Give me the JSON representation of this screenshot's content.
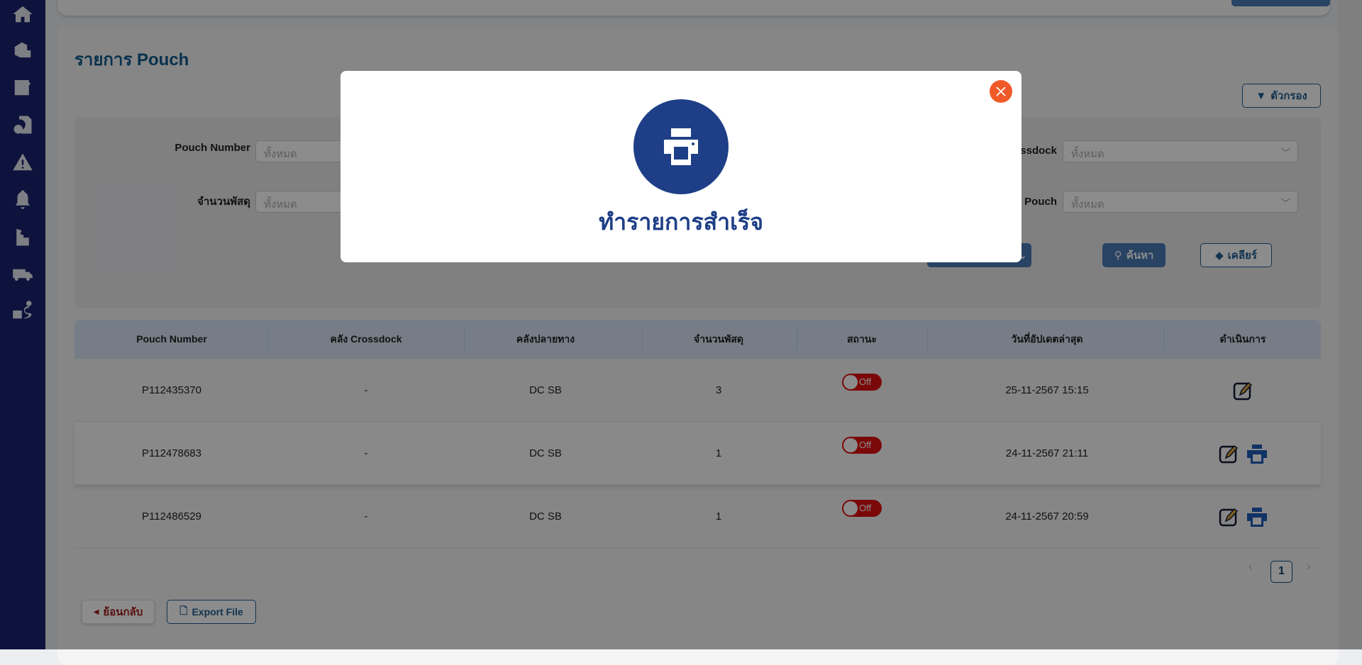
{
  "page": {
    "title": "รายการ Pouch",
    "filter_label": "ตัวกรอง"
  },
  "filters": {
    "pouch_number": {
      "label": "Pouch Number",
      "placeholder": "ทั้งหมด"
    },
    "parcel_count": {
      "label": "จำนวนพัสดุ",
      "placeholder": "ทั้งหมด"
    },
    "crossdock": {
      "label": "คลัง Crossdock",
      "placeholder": "ทั้งหมด"
    },
    "pouch_status": {
      "label": "สถานะ Pouch",
      "placeholder": "ทั้งหมด"
    },
    "search_label": "ค้นหา",
    "clear_label": "เคลียร์"
  },
  "table": {
    "columns": [
      "Pouch Number",
      "คลัง Crossdock",
      "คลังปลายทาง",
      "จำนวนพัสดุ",
      "สถานะ",
      "วันที่อัปเดตล่าสุด",
      "ดำเนินการ"
    ],
    "rows": [
      {
        "pouch": "P112435370",
        "crossdock": "-",
        "dest": "DC SB",
        "count": "3",
        "status": "Off",
        "updated": "25-11-2567 15:15",
        "printable": false
      },
      {
        "pouch": "P112478683",
        "crossdock": "-",
        "dest": "DC SB",
        "count": "1",
        "status": "Off",
        "updated": "24-11-2567 21:11",
        "printable": true
      },
      {
        "pouch": "P112486529",
        "crossdock": "-",
        "dest": "DC SB",
        "count": "1",
        "status": "Off",
        "updated": "24-11-2567 20:59",
        "printable": true
      }
    ]
  },
  "pagination": {
    "current": "1"
  },
  "footer": {
    "back_label": "ย้อนกลับ",
    "export_label": "Export File"
  },
  "modal": {
    "message": "ทำรายการสำเร็จ",
    "icon": "printer-icon"
  },
  "colors": {
    "primary": "#1e3f87",
    "accent": "#1f5d93",
    "close": "#f05a28",
    "toggle_off": "#e01010"
  }
}
